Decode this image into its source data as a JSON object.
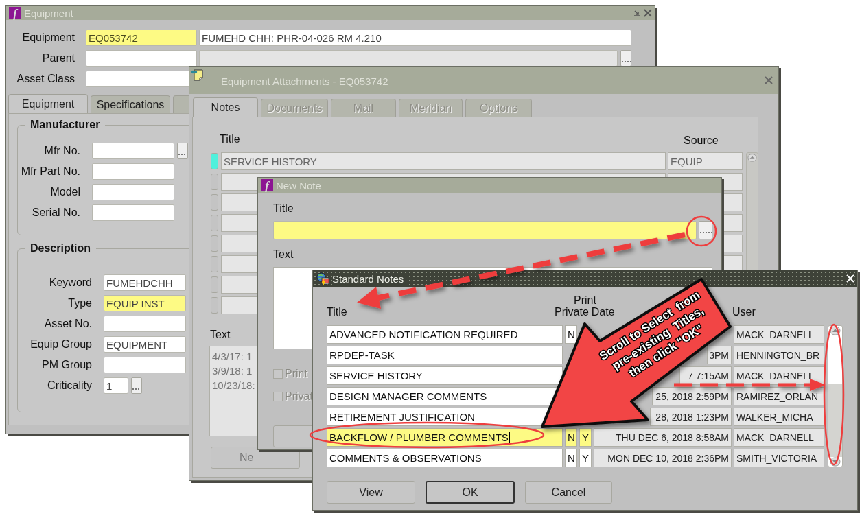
{
  "equipment_window": {
    "icon_glyph": "f",
    "title": "Equipment",
    "header_fields": [
      {
        "label": "Equipment",
        "value": "EQ053742",
        "required": true,
        "link": true,
        "side": {
          "kind": "text",
          "value": "FUMEHD CHH: PHR-04-026 RM 4.210"
        }
      },
      {
        "label": "Parent",
        "required": false,
        "side": {
          "kind": "disabled_lov"
        }
      },
      {
        "label": "Asset Class",
        "required": false
      }
    ],
    "tabs": [
      {
        "label": "Equipment",
        "selected": true
      },
      {
        "label": "Specifications",
        "selected": false
      }
    ],
    "groups": [
      {
        "title": "Manufacturer",
        "fields": [
          {
            "label": "Mfr No.",
            "required": false,
            "lov": true,
            "kind": "text"
          },
          {
            "label": "Mfr Part No.",
            "required": false,
            "lov": false,
            "kind": "text"
          },
          {
            "label": "Model",
            "required": false,
            "lov": false,
            "kind": "text"
          },
          {
            "label": "Serial No.",
            "required": false,
            "lov": false,
            "kind": "text"
          }
        ]
      },
      {
        "title": "Description",
        "fields": [
          {
            "label": "Keyword",
            "value": "FUMEHDCHH",
            "required": false,
            "kind": "text"
          },
          {
            "label": "Type",
            "value": "EQUIP INST",
            "required": true,
            "kind": "text"
          },
          {
            "label": "Asset No.",
            "required": false,
            "kind": "text"
          },
          {
            "label": "Equip Group",
            "value": "EQUIPMENT",
            "required": false,
            "kind": "text"
          },
          {
            "label": "PM Group",
            "required": false,
            "kind": "text"
          },
          {
            "label": "Criticality",
            "value": "1",
            "required": false,
            "lov": true,
            "kind": "short"
          }
        ]
      }
    ]
  },
  "attachments_window": {
    "title": "Equipment Attachments - EQ053742",
    "tabs": [
      {
        "label": "Notes",
        "selected": true
      },
      {
        "label": "Documents",
        "selected": false
      },
      {
        "label": "Mail",
        "selected": false
      },
      {
        "label": "Meridian",
        "selected": false
      },
      {
        "label": "Options",
        "selected": false
      }
    ],
    "columns": [
      "Title",
      "Source"
    ],
    "rows": [
      {
        "title": "SERVICE HISTORY",
        "source": "EQUIP",
        "current": true
      },
      {
        "current": false
      },
      {
        "current": false
      },
      {
        "current": false
      },
      {
        "current": false
      },
      {
        "current": false
      },
      {
        "current": false
      },
      {
        "current": false
      }
    ],
    "text_label": "Text",
    "text_lines": [
      "4/3/17: 1",
      "3/9/18: 1",
      "10/23/18:"
    ],
    "new_button": "Ne"
  },
  "new_note_window": {
    "icon_glyph": "f",
    "title": "New Note",
    "title_label": "Title",
    "title_field": {
      "required": true
    },
    "text_label": "Text",
    "checkboxes": [
      {
        "label": "Print",
        "checked": false
      },
      {
        "label": "Privat",
        "checked": false
      }
    ]
  },
  "standard_notes_window": {
    "title": "Standard Notes",
    "headers": {
      "title": "Title",
      "print": "Print",
      "private": "Private",
      "date": "Date",
      "user": "User"
    },
    "rows": [
      {
        "title": "ADVANCED NOTIFICATION REQUIRED",
        "private": "N",
        "user": "MACK_DARNELL",
        "selected": false
      },
      {
        "title": "RPDEP-TASK",
        "date": "3PM",
        "user": "HENNINGTON_BR",
        "selected": false
      },
      {
        "title": "SERVICE HISTORY",
        "date": "7 7:15AM",
        "user": "MACK_DARNELL",
        "selected": false
      },
      {
        "title": "DESIGN MANAGER COMMENTS",
        "date": "25, 2018 2:59PM",
        "user": "RAMIREZ_ORLAN",
        "selected": false
      },
      {
        "title": "RETIREMENT JUSTIFICATION",
        "date": "28, 2018 1:23PM",
        "user": "WALKER_MICHA",
        "selected": false
      },
      {
        "title": "BACKFLOW / PLUMBER COMMENTS",
        "private": "N",
        "print": "Y",
        "date": "THU DEC 6, 2018 8:58AM",
        "user": "MACK_DARNELL",
        "selected": true
      },
      {
        "title": "COMMENTS & OBSERVATIONS",
        "private": "N",
        "print": "Y",
        "date": "MON DEC 10, 2018 2:36PM",
        "user": "SMITH_VICTORIA",
        "selected": false
      }
    ],
    "buttons": [
      {
        "label": "View",
        "default": false
      },
      {
        "label": "OK",
        "default": true
      },
      {
        "label": "Cancel",
        "default": false
      }
    ]
  },
  "callout": {
    "lines": [
      "Scroll to Select  from",
      "pre-existing  Titles,",
      "then click \"OK\""
    ]
  }
}
